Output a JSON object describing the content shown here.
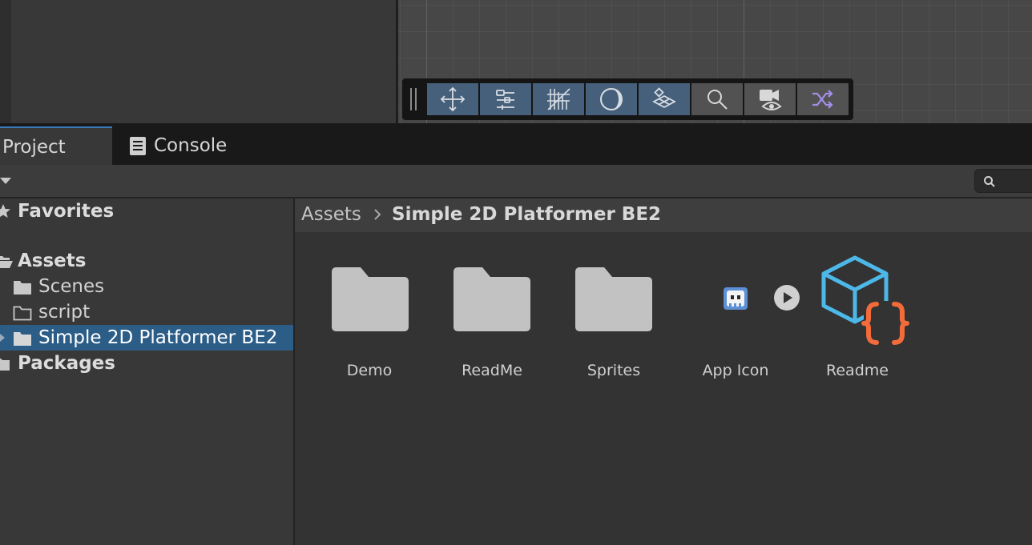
{
  "scene_toolbar": {
    "tools": [
      {
        "icon": "move-tool-icon",
        "active": true
      },
      {
        "icon": "snap-settings-icon",
        "active": true
      },
      {
        "icon": "grid-snap-icon",
        "active": true
      },
      {
        "icon": "shading-mode-icon",
        "active": true
      },
      {
        "icon": "layers-icon",
        "active": true
      },
      {
        "icon": "search-icon",
        "active": false
      },
      {
        "icon": "camera-visibility-icon",
        "active": false
      },
      {
        "icon": "shuffle-icon",
        "active": false
      }
    ],
    "active_color": "#46607c"
  },
  "tabs": {
    "project": "Project",
    "console": "Console"
  },
  "tree": {
    "favorites": "Favorites",
    "assets": "Assets",
    "children": [
      "Scenes",
      "script",
      "Simple 2D Platformer BE2"
    ],
    "packages": "Packages"
  },
  "breadcrumb": {
    "root": "Assets",
    "current": "Simple 2D Platformer BE2"
  },
  "assets": [
    {
      "name": "Demo",
      "icon": "folder-icon"
    },
    {
      "name": "ReadMe",
      "icon": "folder-icon"
    },
    {
      "name": "Sprites",
      "icon": "folder-icon"
    },
    {
      "name": "App Icon",
      "icon": "sprite-icon"
    },
    {
      "name": "Readme",
      "icon": "script-asset-icon"
    }
  ],
  "colors": {
    "selection": "#2c5d87",
    "tab_accent": "#3a79bb",
    "readme_cube": "#4db8e8",
    "readme_braces": "#f26b3a"
  }
}
